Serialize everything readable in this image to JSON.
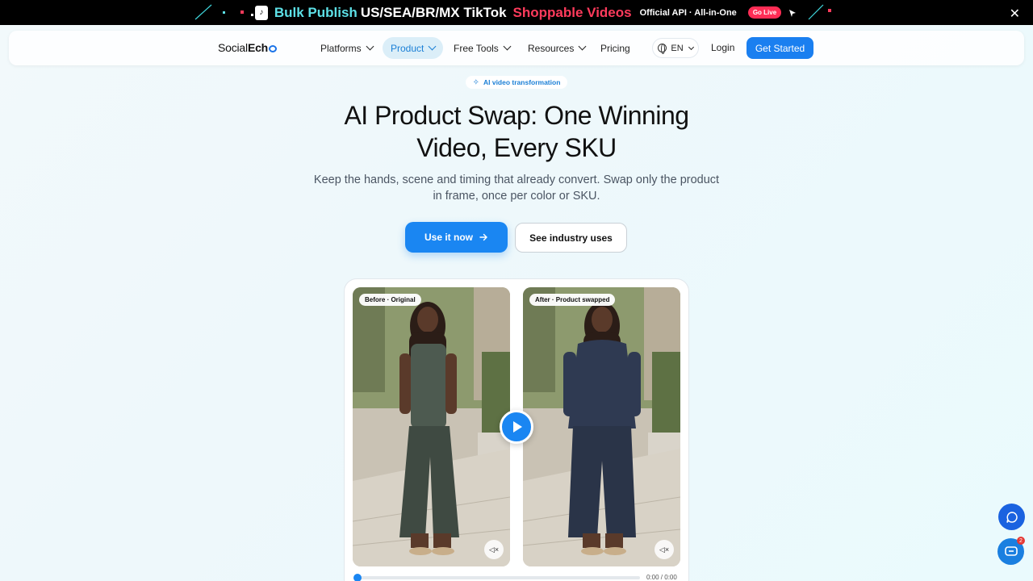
{
  "promo": {
    "part1": "Bulk Publish",
    "part2": "US/SEA/BR/MX TikTok",
    "part3": "Shoppable Videos",
    "part4": "Official API · All-in-One",
    "live": "Go Live",
    "close": "✕"
  },
  "nav": {
    "logo_light": "Social",
    "logo_bold": "Ech",
    "items": [
      {
        "label": "Platforms"
      },
      {
        "label": "Product"
      },
      {
        "label": "Free Tools"
      },
      {
        "label": "Resources"
      },
      {
        "label": "Pricing"
      }
    ],
    "language": "EN",
    "login": "Login",
    "cta": "Get Started"
  },
  "hero": {
    "pill": "AI video transformation",
    "title_line1": "AI Product Swap: One Winning",
    "title_line2": "Video, Every SKU",
    "subtitle_line1": "Keep the hands, scene and timing that already convert. Swap only the product",
    "subtitle_line2": "in frame, once per color or SKU.",
    "primary_button": "Use it now",
    "secondary_button": "See industry uses"
  },
  "video": {
    "before_label": "Before · Original",
    "after_label": "After · Product swapped",
    "time": "0:00 / 0:00",
    "progress": 0
  },
  "floating": {
    "support_badge": "2"
  },
  "colors": {
    "accent": "#1a86f2",
    "promo_cyan": "#5de0e6",
    "promo_red": "#ff3b5c"
  }
}
